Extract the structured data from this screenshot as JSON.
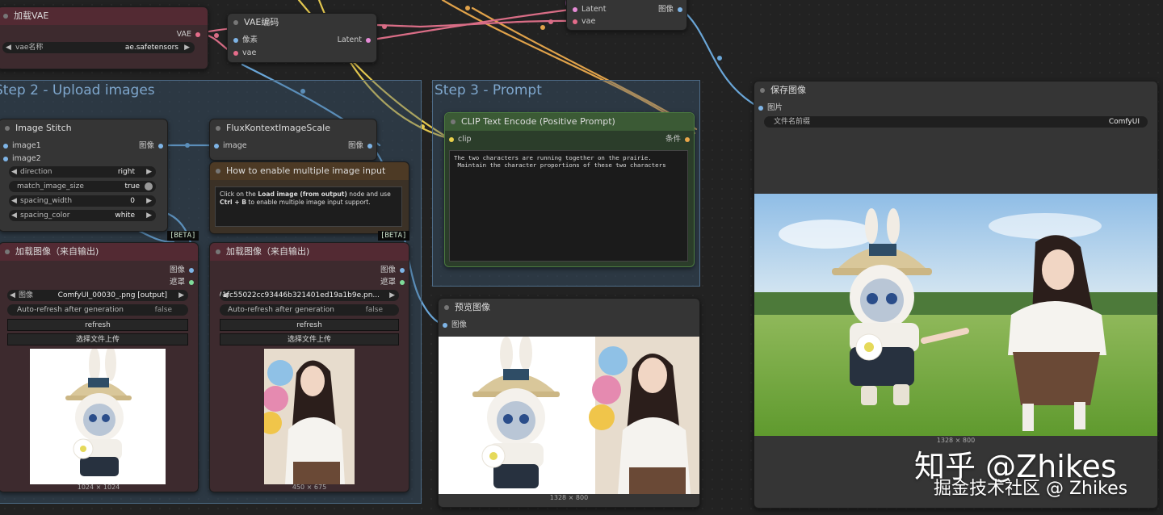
{
  "colors": {
    "wire_yellow": "#e3c74f",
    "wire_blue": "#6aa6d8",
    "wire_pink": "#d96d86",
    "wire_orange": "#e0a24a",
    "socket_blue": "#7eb4e6",
    "socket_pink": "#e56c8a",
    "socket_yellow": "#e9d04a"
  },
  "groups": {
    "step2": "Step 2 - Upload images",
    "step3": "Step 3 - Prompt"
  },
  "load_vae": {
    "title": "加载VAE",
    "output": "VAE",
    "widget_label": "vae名称",
    "widget_value": "ae.safetensors"
  },
  "vae_encode": {
    "title": "VAE编码",
    "input_pixels": "像素",
    "input_vae": "vae",
    "output": "Latent"
  },
  "vae_decode": {
    "input_latent": "Latent",
    "input_vae": "vae",
    "output": "图像"
  },
  "image_stitch": {
    "title": "Image Stitch",
    "in1": "image1",
    "in2": "image2",
    "output": "图像",
    "w_direction_l": "direction",
    "w_direction_v": "right",
    "w_match_l": "match_image_size",
    "w_match_v": "true",
    "w_spacing_l": "spacing_width",
    "w_spacing_v": "0",
    "w_color_l": "spacing_color",
    "w_color_v": "white",
    "badge": "[BETA]"
  },
  "flux_scale": {
    "title": "FluxKontextImageScale",
    "input": "image",
    "output": "图像",
    "badge": "[BETA]"
  },
  "note": {
    "title": "How to enable multiple image input",
    "text_a": "Click on the ",
    "text_b": "Load image (from output)",
    "text_c": " node and use ",
    "text_d": "Ctrl + B",
    "text_e": " to enable multiple image input support."
  },
  "load1": {
    "title": "加载图像（来自输出)",
    "out_image": "图像",
    "out_mask": "遮罩",
    "w_image_l": "图像",
    "w_image_v": "ComfyUI_00030_.png [output]",
    "w_auto_l": "Auto-refresh after generation",
    "w_auto_v": "false",
    "btn_refresh": "refresh",
    "btn_upload": "选择文件上传",
    "size": "1024 × 1024"
  },
  "load2": {
    "title": "加载图像（来自输出)",
    "out_image": "图像",
    "out_mask": "遮罩",
    "w_image_v": "71fc55022cc93446b321401ed19a1b9e.pn...",
    "w_auto_l": "Auto-refresh after generation",
    "w_auto_v": "false",
    "btn_refresh": "refresh",
    "btn_upload": "选择文件上传",
    "size": "450 × 675"
  },
  "clip": {
    "title": "CLIP Text Encode (Positive Prompt)",
    "input": "clip",
    "output": "条件",
    "prompt": "The two characters are running together on the prairie.\n Maintain the character proportions of these two characters"
  },
  "preview": {
    "title": "预览图像",
    "input": "图像",
    "size": "1328 × 800"
  },
  "save": {
    "title": "保存图像",
    "input": "图片",
    "w_prefix_l": "文件名前缀",
    "w_prefix_v": "ComfyUI",
    "size": "1328 × 800"
  },
  "watermark": {
    "big": "知乎 @Zhikes",
    "small": "掘金技术社区 @ Zhikes"
  },
  "icons": {
    "arrow_left": "◀",
    "arrow_right": "▶"
  }
}
